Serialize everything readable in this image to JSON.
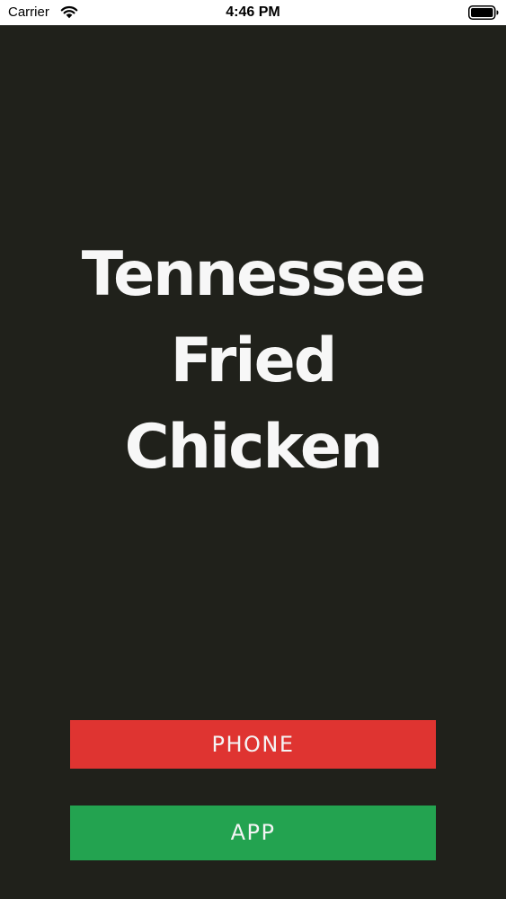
{
  "status_bar": {
    "carrier": "Carrier",
    "time": "4:46 PM",
    "wifi_icon": "wifi-icon",
    "battery_icon": "battery-full-icon"
  },
  "title": {
    "line1": "Tennessee",
    "line2": "Fried",
    "line3": "Chicken"
  },
  "buttons": {
    "phone_label": "PHONE",
    "app_label": "APP"
  },
  "colors": {
    "background": "#20211b",
    "phone_button": "#df3431",
    "app_button": "#23a350",
    "title_text": "#f7f7f7"
  }
}
